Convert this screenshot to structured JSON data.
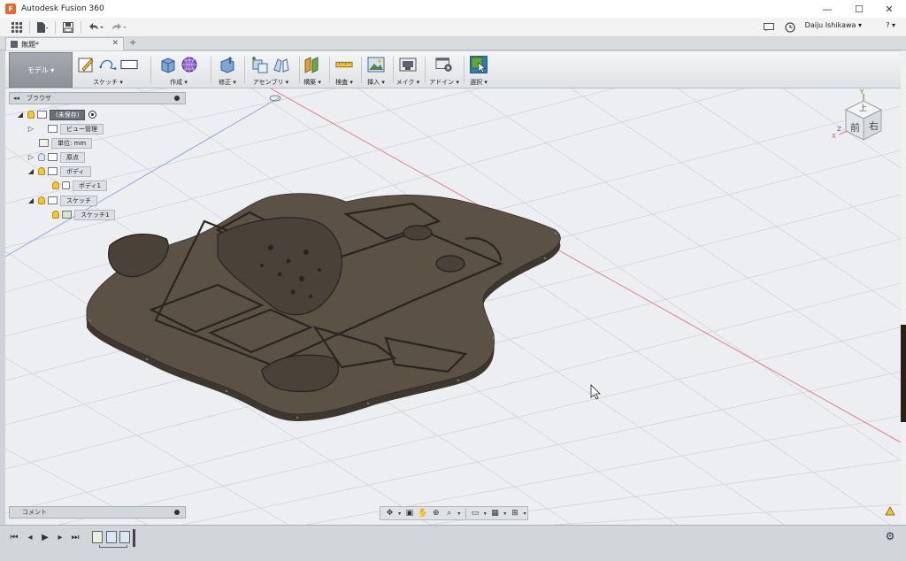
{
  "window": {
    "title": "Autodesk Fusion 360",
    "controls": {
      "minimize": "—",
      "maximize": "☐",
      "close": "✕"
    }
  },
  "appbar": {
    "user_name": "Daiju Ishikawa ▾",
    "help": "? ▾"
  },
  "document_tab": {
    "name": "無題*",
    "close": "✕"
  },
  "toolbar": {
    "workspace": "モデル ▾",
    "groups": [
      {
        "label": "スケッチ ▾"
      },
      {
        "label": "作成 ▾"
      },
      {
        "label": "修正 ▾"
      },
      {
        "label": "アセンブリ ▾"
      },
      {
        "label": "構築 ▾"
      },
      {
        "label": "検査 ▾"
      },
      {
        "label": "挿入 ▾"
      },
      {
        "label": "メイク ▾"
      },
      {
        "label": "アドイン ▾"
      },
      {
        "label": "選択 ▾"
      }
    ]
  },
  "browser": {
    "title": "ブラウザ",
    "collapse": "◂◂",
    "nodes": [
      {
        "label": "(未保存)"
      },
      {
        "label": "ビュー管理"
      },
      {
        "label": "単位: mm"
      },
      {
        "label": "原点"
      },
      {
        "label": "ボディ"
      },
      {
        "label": "ボディ1"
      },
      {
        "label": "スケッチ"
      },
      {
        "label": "スケッチ1"
      }
    ]
  },
  "viewcube": {
    "top": "上",
    "front": "前",
    "right": "右",
    "axis_x": "X",
    "axis_y": "Y",
    "axis_z": "Z"
  },
  "comments": {
    "title": "コメント"
  },
  "colors": {
    "model_top": "#5b5145",
    "model_side": "#3e372f",
    "grid": "#cdd1d6",
    "selection_blue": "#2e7bb6"
  }
}
